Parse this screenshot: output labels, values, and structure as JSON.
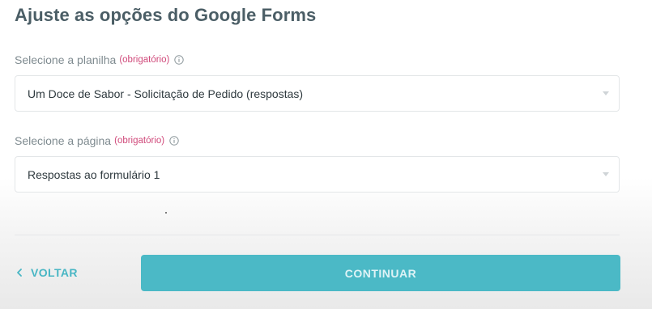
{
  "header": {
    "title": "Ajuste as opções do Google Forms"
  },
  "fields": [
    {
      "label": "Selecione a planilha",
      "required_text": "(obrigatório)",
      "info_icon": "info-icon",
      "value": "Um Doce de Sabor - Solicitação de Pedido (respostas)"
    },
    {
      "label": "Selecione a página",
      "required_text": "(obrigatório)",
      "info_icon": "info-icon",
      "value": "Respostas ao formulário 1"
    }
  ],
  "footer": {
    "back_label": "VOLTAR",
    "back_icon": "chevron-left-icon",
    "continue_label": "CONTINUAR"
  },
  "colors": {
    "title": "#4b5e66",
    "required": "#d0497a",
    "accent": "#4bb9c6",
    "continue_text": "#def3f6"
  }
}
